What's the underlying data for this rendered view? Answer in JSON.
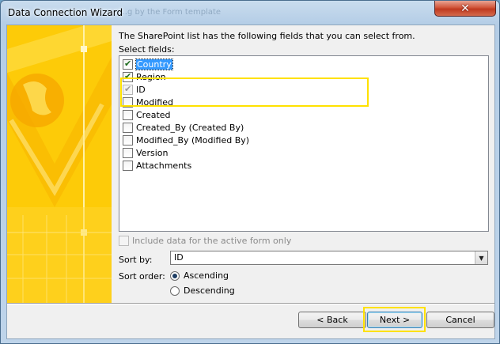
{
  "window": {
    "title": "Data Connection Wizard",
    "background_ghost_title": "…g by the Form template",
    "close_glyph": "✕"
  },
  "wizard": {
    "heading": "The SharePoint list has the following fields that you can select from.",
    "select_label": "Select fields:",
    "fields": [
      {
        "label": "Country",
        "checked": true,
        "disabled": false,
        "selected": true
      },
      {
        "label": "Region",
        "checked": true,
        "disabled": false,
        "selected": false
      },
      {
        "label": "ID",
        "checked": true,
        "disabled": true,
        "selected": false
      },
      {
        "label": "Modified",
        "checked": false,
        "disabled": false,
        "selected": false
      },
      {
        "label": "Created",
        "checked": false,
        "disabled": false,
        "selected": false
      },
      {
        "label": "Created_By (Created By)",
        "checked": false,
        "disabled": false,
        "selected": false
      },
      {
        "label": "Modified_By (Modified By)",
        "checked": false,
        "disabled": false,
        "selected": false
      },
      {
        "label": "Version",
        "checked": false,
        "disabled": false,
        "selected": false
      },
      {
        "label": "Attachments",
        "checked": false,
        "disabled": false,
        "selected": false
      }
    ],
    "include_label": "Include data for the active form only",
    "sort_by_label": "Sort by:",
    "sort_by_value": "ID",
    "sort_order_label": "Sort order:",
    "ascending_label": "Ascending",
    "descending_label": "Descending",
    "sort_order_selected": "Ascending"
  },
  "buttons": {
    "back": "< Back",
    "next": "Next >",
    "cancel": "Cancel"
  },
  "colors": {
    "banner_yellow": "#fdc800",
    "highlight_frame": "#ffe100",
    "selection_blue": "#3399ff"
  }
}
